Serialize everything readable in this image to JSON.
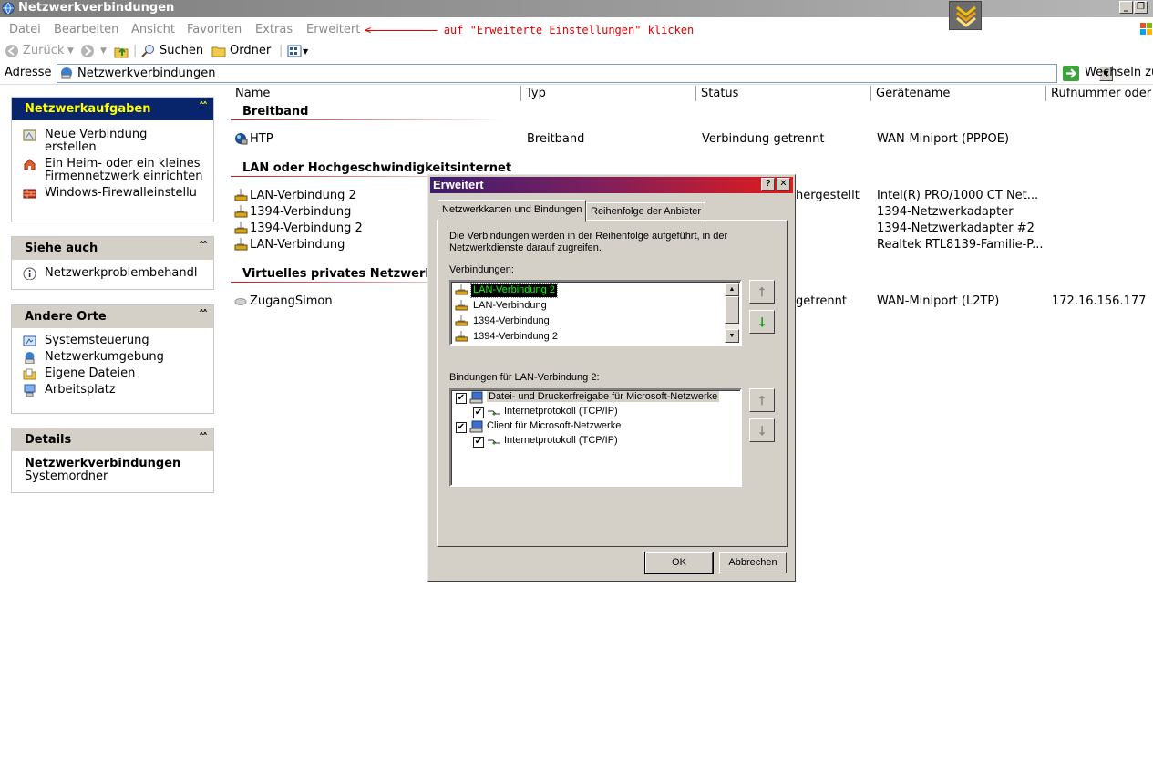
{
  "window": {
    "title": "Netzwerkverbindungen",
    "min_glyph": "_",
    "restore_glyph": "❐",
    "close_glyph": "✕"
  },
  "menu": {
    "items": [
      "Datei",
      "Bearbeiten",
      "Ansicht",
      "Favoriten",
      "Extras",
      "Erweitert"
    ],
    "hint_arrow": "<----------",
    "hint_text": "auf \"Erweiterte Einstellungen\" klicken"
  },
  "toolbar": {
    "back": "Zurück",
    "search": "Suchen",
    "folders": "Ordner"
  },
  "address": {
    "label": "Adresse",
    "value": "Netzwerkverbindungen",
    "go_label": "Wechseln zu"
  },
  "panes": {
    "tasks": {
      "title": "Netzwerkaufgaben",
      "items": [
        "Neue Verbindung erstellen",
        "Ein Heim- oder ein kleines Firmennetzwerk einrichten",
        "Windows-Firewalleinstellungen ändern"
      ]
    },
    "see_also": {
      "title": "Siehe auch",
      "items": [
        "Netzwerkproblembehandlung"
      ]
    },
    "other": {
      "title": "Andere Orte",
      "items": [
        "Systemsteuerung",
        "Netzwerkumgebung",
        "Eigene Dateien",
        "Arbeitsplatz"
      ]
    },
    "details": {
      "title": "Details",
      "name": "Netzwerkverbindungen",
      "type": "Systemordner"
    }
  },
  "columns": [
    "Name",
    "Typ",
    "Status",
    "Gerätename",
    "Rufnummer oder Host"
  ],
  "groups": [
    {
      "title": "Breitband",
      "rows": [
        {
          "name": "HTP",
          "type": "Breitband",
          "status": "Verbindung getrennt",
          "device": "WAN-Miniport (PPPOE)",
          "phone": ""
        }
      ]
    },
    {
      "title": "LAN oder Hochgeschwindigkeitsinternet",
      "rows": [
        {
          "name": "LAN-Verbindung 2",
          "type": "",
          "status": "hergestellt",
          "device": "Intel(R) PRO/1000 CT Net...",
          "phone": ""
        },
        {
          "name": "1394-Verbindung",
          "type": "",
          "status": "",
          "device": "1394-Netzwerkadapter",
          "phone": ""
        },
        {
          "name": "1394-Verbindung 2",
          "type": "",
          "status": "",
          "device": "1394-Netzwerkadapter #2",
          "phone": ""
        },
        {
          "name": "LAN-Verbindung",
          "type": "",
          "status": "",
          "device": "Realtek RTL8139-Familie-P...",
          "phone": ""
        }
      ]
    },
    {
      "title": "Virtuelles privates Netzwerk",
      "rows": [
        {
          "name": "ZugangSimon",
          "type": "",
          "status": "getrennt",
          "device": "WAN-Miniport (L2TP)",
          "phone": "172.16.156.177"
        }
      ]
    }
  ],
  "dialog": {
    "title": "Erweitert",
    "help_glyph": "?",
    "close_glyph": "✕",
    "tabs": [
      "Netzwerkkarten und Bindungen",
      "Reihenfolge der Anbieter"
    ],
    "description": [
      "Die Verbindungen werden in der Reihenfolge aufgeführt, in der",
      "Netzwerkdienste darauf zugreifen."
    ],
    "connections_label": "Verbindungen:",
    "connections": [
      "LAN-Verbindung 2",
      "LAN-Verbindung",
      "1394-Verbindung",
      "1394-Verbindung 2"
    ],
    "bindings_label": "Bindungen für LAN-Verbindung 2:",
    "bindings": [
      {
        "label": "Datei- und Druckerfreigabe für Microsoft-Netzwerke",
        "checked": true,
        "level": 0
      },
      {
        "label": "Internetprotokoll (TCP/IP)",
        "checked": true,
        "level": 1
      },
      {
        "label": "Client für Microsoft-Netzwerke",
        "checked": true,
        "level": 0
      },
      {
        "label": "Internetprotokoll (TCP/IP)",
        "checked": true,
        "level": 1
      }
    ],
    "ok": "OK",
    "cancel": "Abbrechen"
  },
  "colors": {
    "dialog_face": "#d4d0c8",
    "task_header": "#08246b",
    "task_header_text": "#ffff00",
    "hint": "#e00000",
    "selection_text": "#00ff00",
    "group_line": "#c4161c"
  }
}
